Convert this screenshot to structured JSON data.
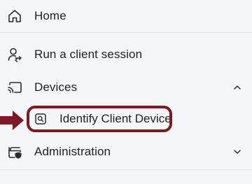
{
  "nav": {
    "items": [
      {
        "label": "Home",
        "icon": "home-icon"
      },
      {
        "label": "Run a client session",
        "icon": "user-transfer-icon"
      },
      {
        "label": "Devices",
        "icon": "cast-device-icon",
        "expanded": true,
        "chevron": "chevron-up-icon"
      },
      {
        "label": "Identify Client Device",
        "icon": "search-device-icon",
        "submenu_of": "Devices"
      },
      {
        "label": "Administration",
        "icon": "admin-shield-icon",
        "expanded": false,
        "chevron": "chevron-down-icon"
      }
    ]
  },
  "annotation": {
    "color": "#7b1a25"
  }
}
